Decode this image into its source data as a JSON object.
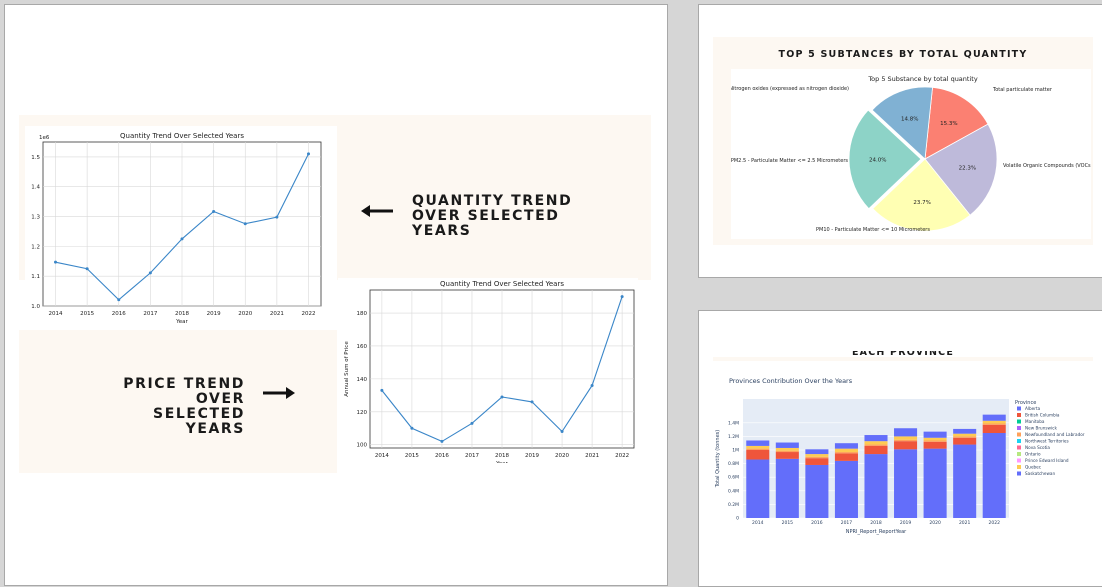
{
  "slide_left": {
    "quantity_label": [
      "QUANTITY TREND",
      "OVER SELECTED",
      "YEARS"
    ],
    "price_label": [
      "PRICE TREND",
      "OVER SELECTED",
      "YEARS"
    ],
    "arrow_left_icon": "arrow-left-icon",
    "arrow_right_icon": "arrow-right-icon"
  },
  "slide_right_top": {
    "heading": "TOP 5 SUBTANCES BY TOTAL QUANTITY"
  },
  "slide_right_bottom": {
    "heading_partial": "EACH PROVINCE"
  },
  "chart_data": [
    {
      "type": "line",
      "title": "Quantity Trend Over Selected Years",
      "xlabel": "Year",
      "ylabel": "",
      "multiplier": "1e6",
      "x": [
        "2014",
        "2015",
        "2016",
        "2017",
        "2018",
        "2019",
        "2020",
        "2021",
        "2022"
      ],
      "y": [
        1.147,
        1.125,
        1.021,
        1.111,
        1.225,
        1.317,
        1.276,
        1.298,
        1.51
      ],
      "ylim": [
        1.0,
        1.55
      ],
      "yticks": [
        "1.0",
        "1.1",
        "1.2",
        "1.3",
        "1.4",
        "1.5"
      ],
      "color": "#3a86c8",
      "grid": true
    },
    {
      "type": "line",
      "title": "Quantity Trend Over Selected Years",
      "xlabel": "Year",
      "ylabel": "Annual Sum of Price",
      "x": [
        "2014",
        "2015",
        "2016",
        "2017",
        "2018",
        "2019",
        "2020",
        "2021",
        "2022"
      ],
      "y": [
        133,
        110,
        102,
        113,
        129,
        126,
        108,
        136,
        190
      ],
      "ylim": [
        98,
        194
      ],
      "yticks": [
        "100",
        "120",
        "140",
        "160",
        "180"
      ],
      "color": "#3a86c8",
      "grid": true
    },
    {
      "type": "pie",
      "title": "Top 5 Substance by total quantity",
      "slices": [
        {
          "label": "Total particulate matter",
          "value": 15.3,
          "pct": "15.3%",
          "color": "#fb8072"
        },
        {
          "label": "Volatile Organic Compounds (VOCs)",
          "value": 22.3,
          "pct": "22.3%",
          "color": "#bebada"
        },
        {
          "label": "PM10 - Particulate Matter <= 10 Micrometers",
          "value": 23.7,
          "pct": "23.7%",
          "color": "#ffffb3"
        },
        {
          "label": "PM2.5 - Particulate Matter <= 2.5 Micrometers",
          "value": 24.0,
          "pct": "24.0%",
          "color": "#8dd3c7"
        },
        {
          "label": "Nitrogen oxides (expressed as nitrogen dioxide)",
          "value": 14.8,
          "pct": "14.8%",
          "color": "#80b1d3"
        }
      ]
    },
    {
      "type": "bar",
      "stacked": true,
      "title": "Provinces Contribution Over the Years",
      "xlabel": "NPRI_Report_ReportYear",
      "ylabel": "Total Quantity (tonnes)",
      "legend_title": "Province",
      "legend_position": "right",
      "categories": [
        "2014",
        "2015",
        "2016",
        "2017",
        "2018",
        "2019",
        "2020",
        "2021",
        "2022"
      ],
      "ylim": [
        0,
        1.75
      ],
      "yticks": [
        "0",
        "0.2M",
        "0.4M",
        "0.6M",
        "0.8M",
        "1M",
        "1.2M",
        "1.4M"
      ],
      "series": [
        {
          "name": "Alberta",
          "color": "#636efa",
          "values": [
            0.86,
            0.87,
            0.78,
            0.84,
            0.94,
            1.01,
            1.02,
            1.08,
            1.25
          ]
        },
        {
          "name": "British Columbia",
          "color": "#ef553b",
          "values": [
            0.14,
            0.1,
            0.1,
            0.11,
            0.12,
            0.12,
            0.1,
            0.1,
            0.12
          ]
        },
        {
          "name": "Manitoba",
          "color": "#00cc96",
          "values": [
            0.0,
            0.0,
            0.0,
            0.0,
            0.0,
            0.0,
            0.0,
            0.0,
            0.0
          ]
        },
        {
          "name": "New Brunswick",
          "color": "#ab63fa",
          "values": [
            0.0,
            0.0,
            0.0,
            0.0,
            0.0,
            0.0,
            0.0,
            0.0,
            0.0
          ]
        },
        {
          "name": "Newfoundland and Labrador",
          "color": "#ffa15a",
          "values": [
            0.02,
            0.02,
            0.02,
            0.02,
            0.02,
            0.02,
            0.02,
            0.02,
            0.02
          ]
        },
        {
          "name": "Northwest Territories",
          "color": "#19d3f3",
          "values": [
            0.0,
            0.0,
            0.0,
            0.0,
            0.0,
            0.0,
            0.0,
            0.0,
            0.0
          ]
        },
        {
          "name": "Nova Scotia",
          "color": "#ff6692",
          "values": [
            0.0,
            0.0,
            0.0,
            0.0,
            0.0,
            0.0,
            0.0,
            0.0,
            0.0
          ]
        },
        {
          "name": "Ontario",
          "color": "#b6e880",
          "values": [
            0.0,
            0.0,
            0.0,
            0.0,
            0.0,
            0.0,
            0.0,
            0.0,
            0.0
          ]
        },
        {
          "name": "Prince Edward Island",
          "color": "#ff97ff",
          "values": [
            0.0,
            0.0,
            0.0,
            0.0,
            0.0,
            0.0,
            0.0,
            0.0,
            0.0
          ]
        },
        {
          "name": "Quebec",
          "color": "#fecb52",
          "values": [
            0.04,
            0.04,
            0.04,
            0.05,
            0.05,
            0.05,
            0.04,
            0.04,
            0.04
          ]
        },
        {
          "name": "Saskatchewan",
          "color": "#636efa",
          "values": [
            0.08,
            0.08,
            0.07,
            0.08,
            0.09,
            0.12,
            0.09,
            0.07,
            0.09
          ]
        }
      ]
    }
  ]
}
